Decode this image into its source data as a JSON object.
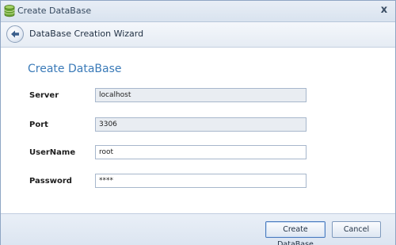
{
  "window": {
    "title": "Create DataBase",
    "close_glyph": "x"
  },
  "wizard": {
    "title": "DataBase Creation Wizard",
    "back_icon": "back-arrow-icon"
  },
  "page": {
    "title": "Create DataBase"
  },
  "form": {
    "server": {
      "label": "Server",
      "value": "localhost"
    },
    "port": {
      "label": "Port",
      "value": "3306"
    },
    "username": {
      "label": "UserName",
      "value": "root"
    },
    "password": {
      "label": "Password",
      "value": "****"
    }
  },
  "buttons": {
    "create": "Create DataBase",
    "cancel": "Cancel"
  },
  "colors": {
    "accent": "#3a7ab8",
    "readonly_field": "#e9edf2"
  }
}
